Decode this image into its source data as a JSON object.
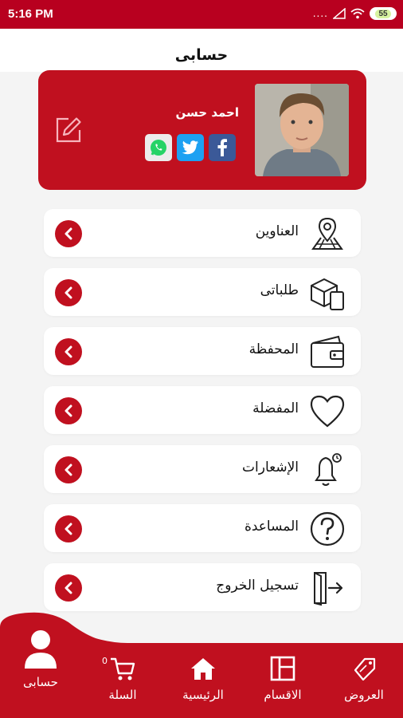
{
  "status_bar": {
    "time": "5:16 PM",
    "dots": "....",
    "battery": "55"
  },
  "header": {
    "title": "حسابى"
  },
  "profile": {
    "name": "احمد حسن"
  },
  "menu": [
    {
      "label": "العناوين",
      "icon": "map-pin-icon"
    },
    {
      "label": "طلباتى",
      "icon": "boxes-icon"
    },
    {
      "label": "المحفظة",
      "icon": "wallet-icon"
    },
    {
      "label": "المفضلة",
      "icon": "heart-icon"
    },
    {
      "label": "الإشعارات",
      "icon": "bell-icon"
    },
    {
      "label": "المساعدة",
      "icon": "help-icon"
    },
    {
      "label": "تسجيل الخروج",
      "icon": "logout-icon"
    }
  ],
  "bottom_nav": {
    "account": "حسابى",
    "cart": "السلة",
    "cart_count": "0",
    "home": "الرئيسية",
    "categories": "الاقسام",
    "offers": "العروض"
  },
  "colors": {
    "accent": "#c0101f",
    "background": "#f4f4f4"
  }
}
